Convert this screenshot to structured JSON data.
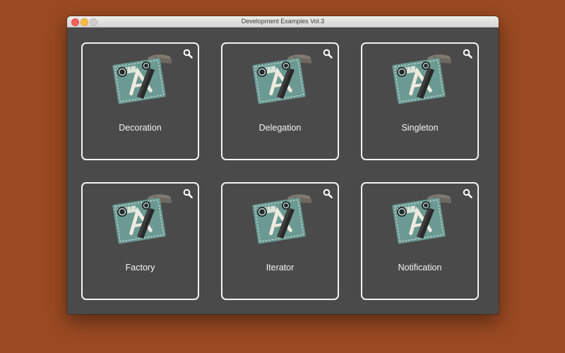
{
  "window": {
    "title": "Development Examples Vol.3"
  },
  "colors": {
    "desktop": "#9a4a22",
    "window_background": "#4a4a4a",
    "card_border": "#f2f2f2",
    "icon_blueprint": "#6a9a92"
  },
  "cards": [
    {
      "label": "Decoration",
      "icon": "xcode-icon",
      "action_icon": "search-icon"
    },
    {
      "label": "Delegation",
      "icon": "xcode-icon",
      "action_icon": "search-icon"
    },
    {
      "label": "Singleton",
      "icon": "xcode-icon",
      "action_icon": "search-icon"
    },
    {
      "label": "Factory",
      "icon": "xcode-icon",
      "action_icon": "search-icon"
    },
    {
      "label": "Iterator",
      "icon": "xcode-icon",
      "action_icon": "search-icon"
    },
    {
      "label": "Notification",
      "icon": "xcode-icon",
      "action_icon": "search-icon"
    }
  ]
}
